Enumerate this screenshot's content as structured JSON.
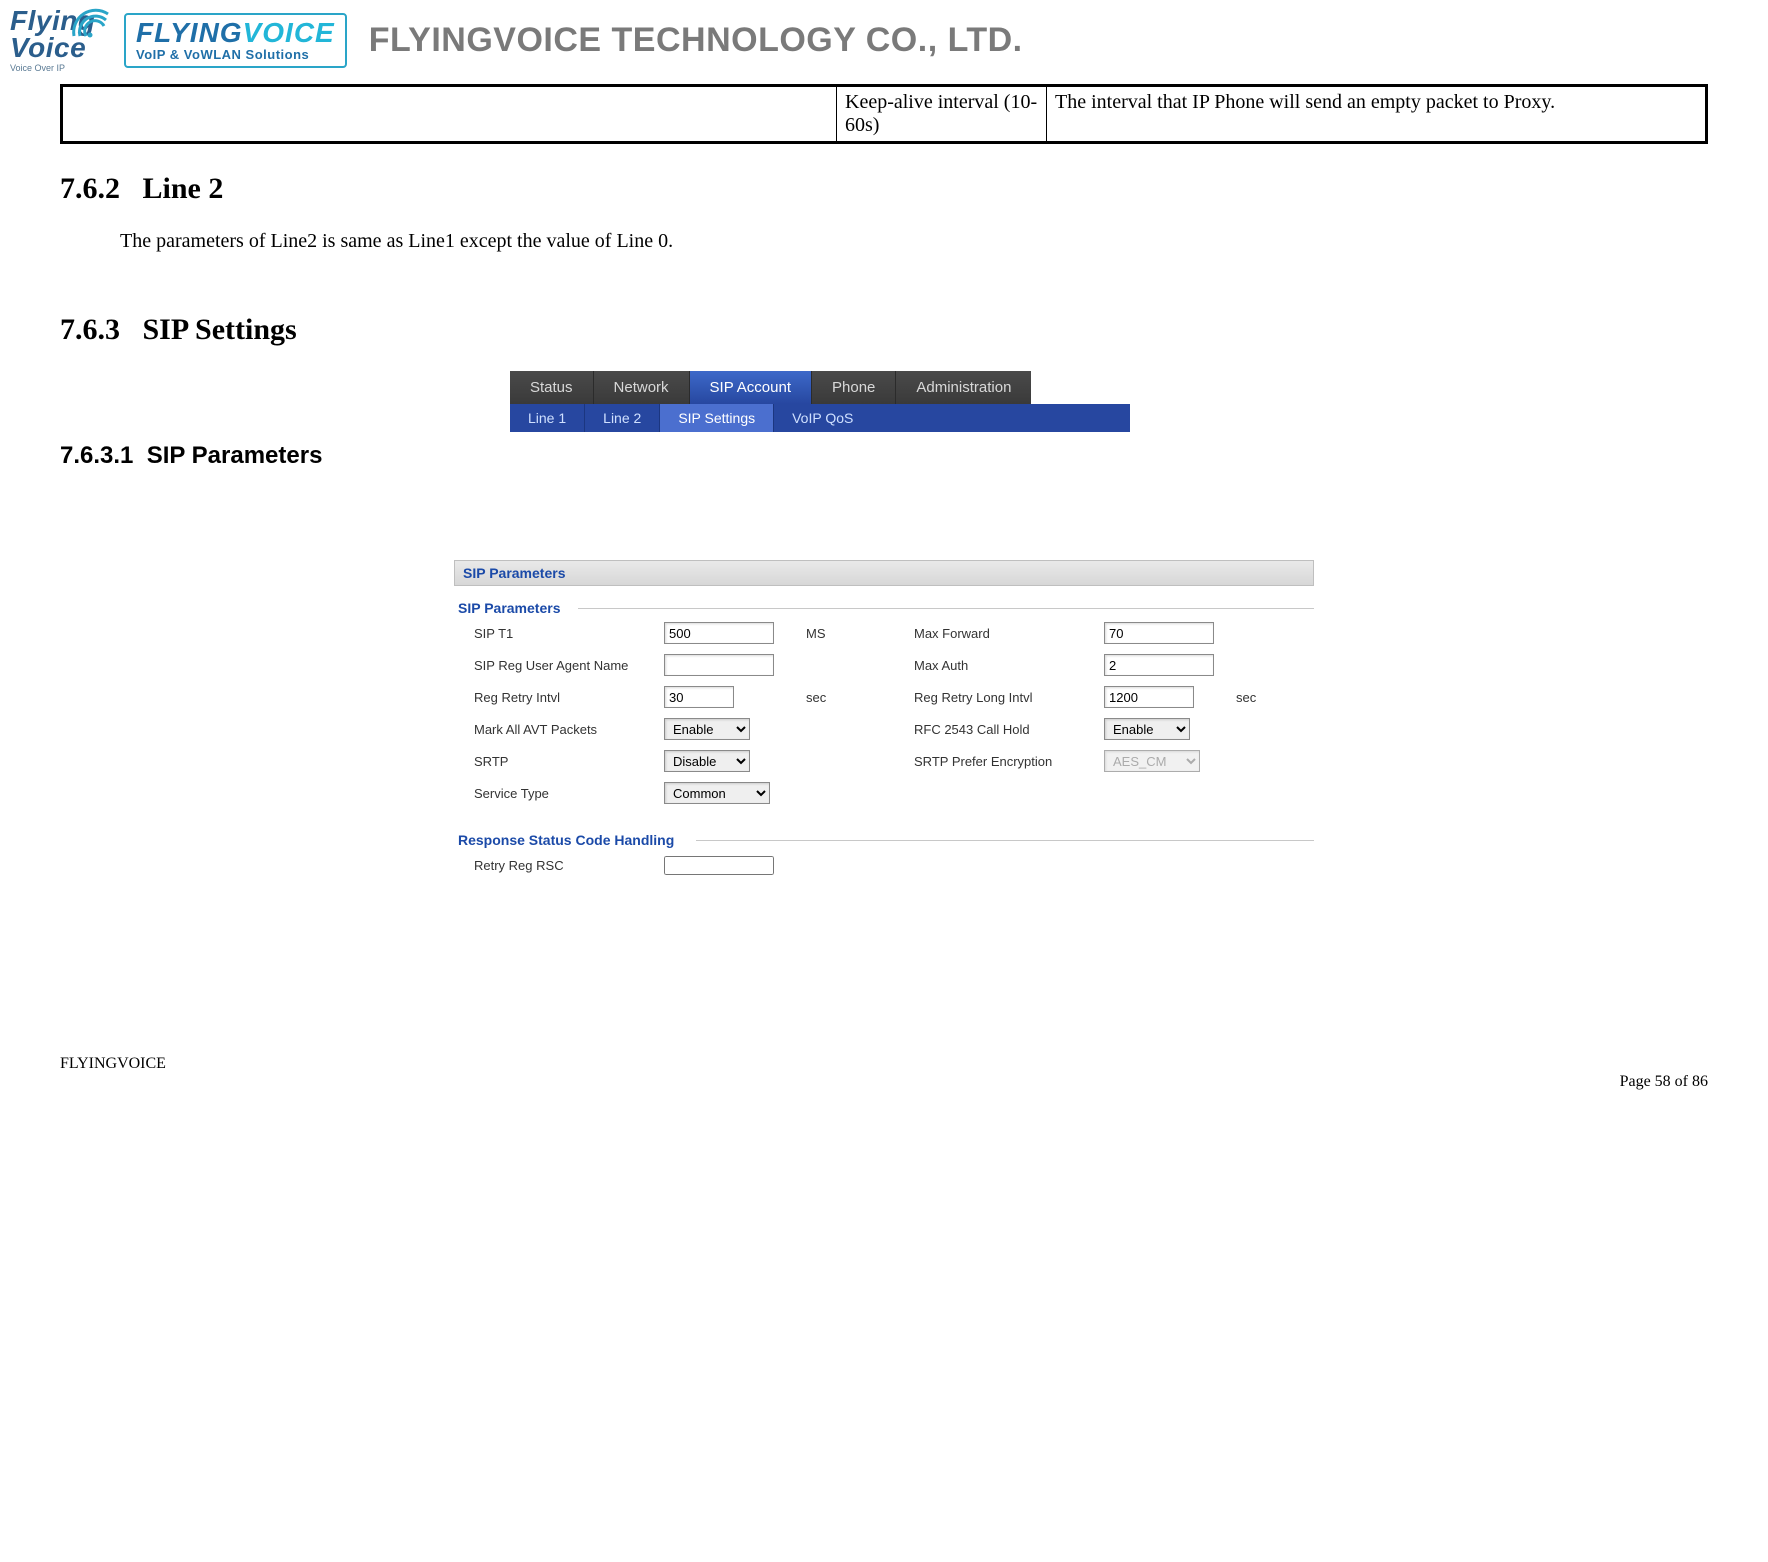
{
  "header": {
    "logo_flying": "Flying",
    "logo_voice": "Voice",
    "logo_sub": "Voice Over IP",
    "brand_main": "FLYINGVOICE",
    "brand_sub": "VoIP & VoWLAN Solutions",
    "company": "FLYINGVOICE TECHNOLOGY CO., LTD."
  },
  "toptable": {
    "col2": "Keep-alive interval (10-60s)",
    "col3": "The interval that IP Phone will send an empty packet to Proxy."
  },
  "sections": {
    "s1_num": "7.6.2",
    "s1_title": "Line 2",
    "s1_body": "The parameters of Line2 is same as Line1 except the value of Line 0.",
    "s2_num": "7.6.3",
    "s2_title": "SIP Settings",
    "s3_num": "7.6.3.1",
    "s3_title": "SIP Parameters"
  },
  "nav": {
    "top": [
      "Status",
      "Network",
      "SIP Account",
      "Phone",
      "Administration"
    ],
    "top_active": 2,
    "sub": [
      "Line 1",
      "Line 2",
      "SIP Settings",
      "VoIP QoS"
    ],
    "sub_active": 2
  },
  "panel": {
    "title": "SIP Parameters",
    "group1": "SIP Parameters",
    "group2": "Response Status Code Handling",
    "fields": {
      "sip_t1": {
        "label": "SIP T1",
        "value": "500",
        "unit": "MS"
      },
      "max_forward": {
        "label": "Max Forward",
        "value": "70"
      },
      "user_agent": {
        "label": "SIP Reg User Agent Name",
        "value": ""
      },
      "max_auth": {
        "label": "Max Auth",
        "value": "2"
      },
      "reg_retry": {
        "label": "Reg Retry Intvl",
        "value": "30",
        "unit": "sec"
      },
      "reg_retry_long": {
        "label": "Reg Retry Long Intvl",
        "value": "1200",
        "unit": "sec"
      },
      "mark_avt": {
        "label": "Mark All AVT Packets",
        "value": "Enable"
      },
      "rfc_callhold": {
        "label": "RFC 2543 Call Hold",
        "value": "Enable"
      },
      "srtp": {
        "label": "SRTP",
        "value": "Disable"
      },
      "srtp_enc": {
        "label": "SRTP Prefer Encryption",
        "value": "AES_CM"
      },
      "service_type": {
        "label": "Service Type",
        "value": "Common"
      },
      "retry_reg_rsc": {
        "label": "Retry Reg RSC",
        "value": ""
      }
    }
  },
  "footer": {
    "center": "FLYINGVOICE",
    "right": "Page  58  of  86"
  }
}
